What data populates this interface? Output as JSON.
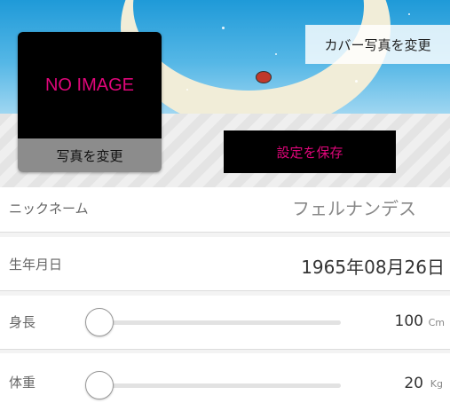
{
  "header": {
    "cover_button_label": "カバー写真を変更",
    "photo_placeholder": "NO IMAGE",
    "change_photo_label": "写真を変更",
    "save_button_label": "設定を保存"
  },
  "profile": {
    "nickname_label": "ニックネーム",
    "nickname_value": "フェルナンデス",
    "birthday_label": "生年月日",
    "birthday_value": "1965年08月26日",
    "height_label": "身長",
    "height_value": "100",
    "height_unit": "Cm",
    "weight_label": "体重",
    "weight_value": "20",
    "weight_unit": "Kg"
  },
  "colors": {
    "accent": "#e0067a",
    "sky": "#3aa9e0",
    "button_dark": "#000000"
  },
  "icons": [
    "slider-thumb",
    "slider-thumb"
  ]
}
